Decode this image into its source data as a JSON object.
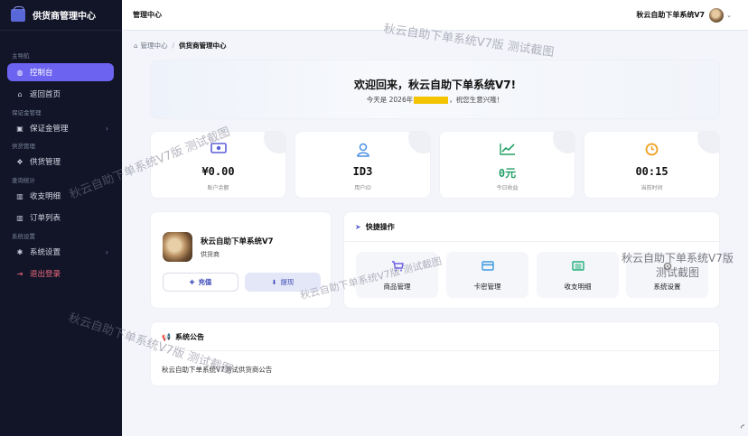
{
  "sidebar": {
    "brand": "供货商管理中心",
    "sections": {
      "main": "主导航",
      "deposit": "保证金管理",
      "supply": "供货管理",
      "query": "查询统计",
      "system": "系统设置"
    },
    "items": {
      "dashboard": "控制台",
      "home": "返回首页",
      "deposit": "保证金管理",
      "supply": "供货管理",
      "income": "收支明细",
      "orders": "订单列表",
      "settings": "系统设置",
      "logout": "退出登录"
    }
  },
  "topbar": {
    "title": "管理中心",
    "user": "秋云自助下单系统V7"
  },
  "breadcrumb": {
    "home": "管理中心",
    "current": "供货商管理中心"
  },
  "welcome": {
    "title": "欢迎回来，秋云自助下单系统V7!",
    "sub_prefix": "今天是 2026年",
    "sub_suffix": "，祝您生意兴隆！"
  },
  "stats": [
    {
      "value": "¥0.00",
      "label": "账户余额",
      "icon": "money-bill-icon"
    },
    {
      "value": "ID3",
      "label": "用户ID",
      "icon": "user-icon"
    },
    {
      "value": "0元",
      "label": "今日收益",
      "icon": "chart-line-icon"
    },
    {
      "value": "00:15",
      "label": "当前时间",
      "icon": "clock-icon"
    }
  ],
  "profile": {
    "name": "秋云自助下单系统V7",
    "role": "供货商",
    "recharge": "充值",
    "withdraw": "提现"
  },
  "quick": {
    "title": "快捷操作",
    "items": [
      "商品管理",
      "卡密管理",
      "收支明细",
      "系统设置"
    ]
  },
  "notice": {
    "title": "系统公告",
    "text": "秋云自助下单系统V7测试供货商公告"
  },
  "watermarks": {
    "top": "秋云自助下单系统V7版 测试截图",
    "right_line1": "秋云自助下单系统V7版",
    "right_line2": "测试截图"
  },
  "colors": {
    "sidebar_bg": "#111527",
    "accent": "#6c63f0",
    "logout": "#f06a7d",
    "income_green": "#22a065"
  }
}
